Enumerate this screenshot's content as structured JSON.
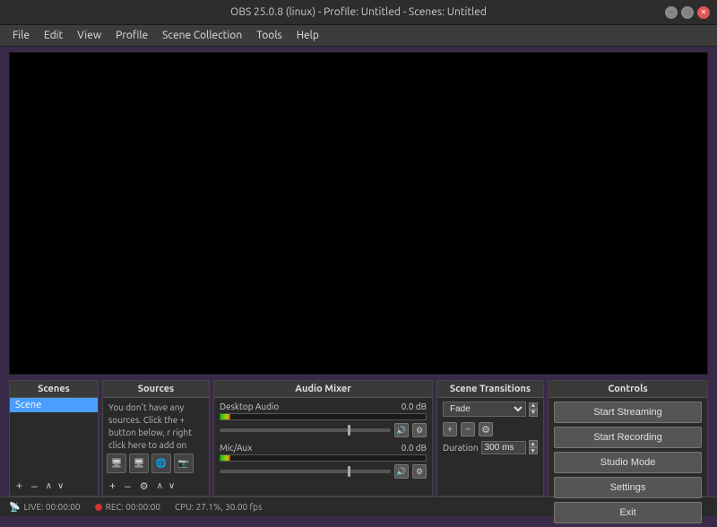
{
  "titlebar": {
    "title": "OBS 25.0.8 (linux) - Profile: Untitled - Scenes: Untitled",
    "btn_minimize": "–",
    "btn_maximize": "□",
    "btn_close": "✕"
  },
  "menubar": {
    "items": [
      "File",
      "Edit",
      "View",
      "Profile",
      "Scene Collection",
      "Tools",
      "Help"
    ]
  },
  "panels": {
    "scenes": {
      "header": "Scenes",
      "items": [
        "Scene"
      ],
      "add_btn": "+",
      "remove_btn": "–",
      "up_btn": "∧",
      "down_btn": "∨"
    },
    "sources": {
      "header": "Sources",
      "empty_text": "You don't have any sources. Click the + button below, r right click here to add on",
      "icons": [
        "🖥",
        "🖥",
        "🌐",
        "📷"
      ],
      "add_btn": "+",
      "remove_btn": "–",
      "gear_btn": "⚙",
      "up_btn": "∧",
      "down_btn": "∨"
    },
    "audio_mixer": {
      "header": "Audio Mixer",
      "channels": [
        {
          "name": "Desktop Audio",
          "db": "0.0 dB",
          "meter_pct": 5
        },
        {
          "name": "Mic/Aux",
          "db": "0.0 dB",
          "meter_pct": 5
        }
      ]
    },
    "scene_transitions": {
      "header": "Scene Transitions",
      "transition": "Fade",
      "add_btn": "+",
      "remove_btn": "–",
      "config_btn": "⚙",
      "duration_label": "Duration",
      "duration_value": "300 ms"
    },
    "controls": {
      "header": "Controls",
      "start_streaming": "Start Streaming",
      "start_recording": "Start Recording",
      "studio_mode": "Studio Mode",
      "settings": "Settings",
      "exit": "Exit"
    }
  },
  "statusbar": {
    "live_icon": "📡",
    "live_label": "LIVE: 00:00:00",
    "rec_label": "REC: 00:00:00",
    "cpu_label": "CPU: 27.1%, 30.00 fps"
  }
}
